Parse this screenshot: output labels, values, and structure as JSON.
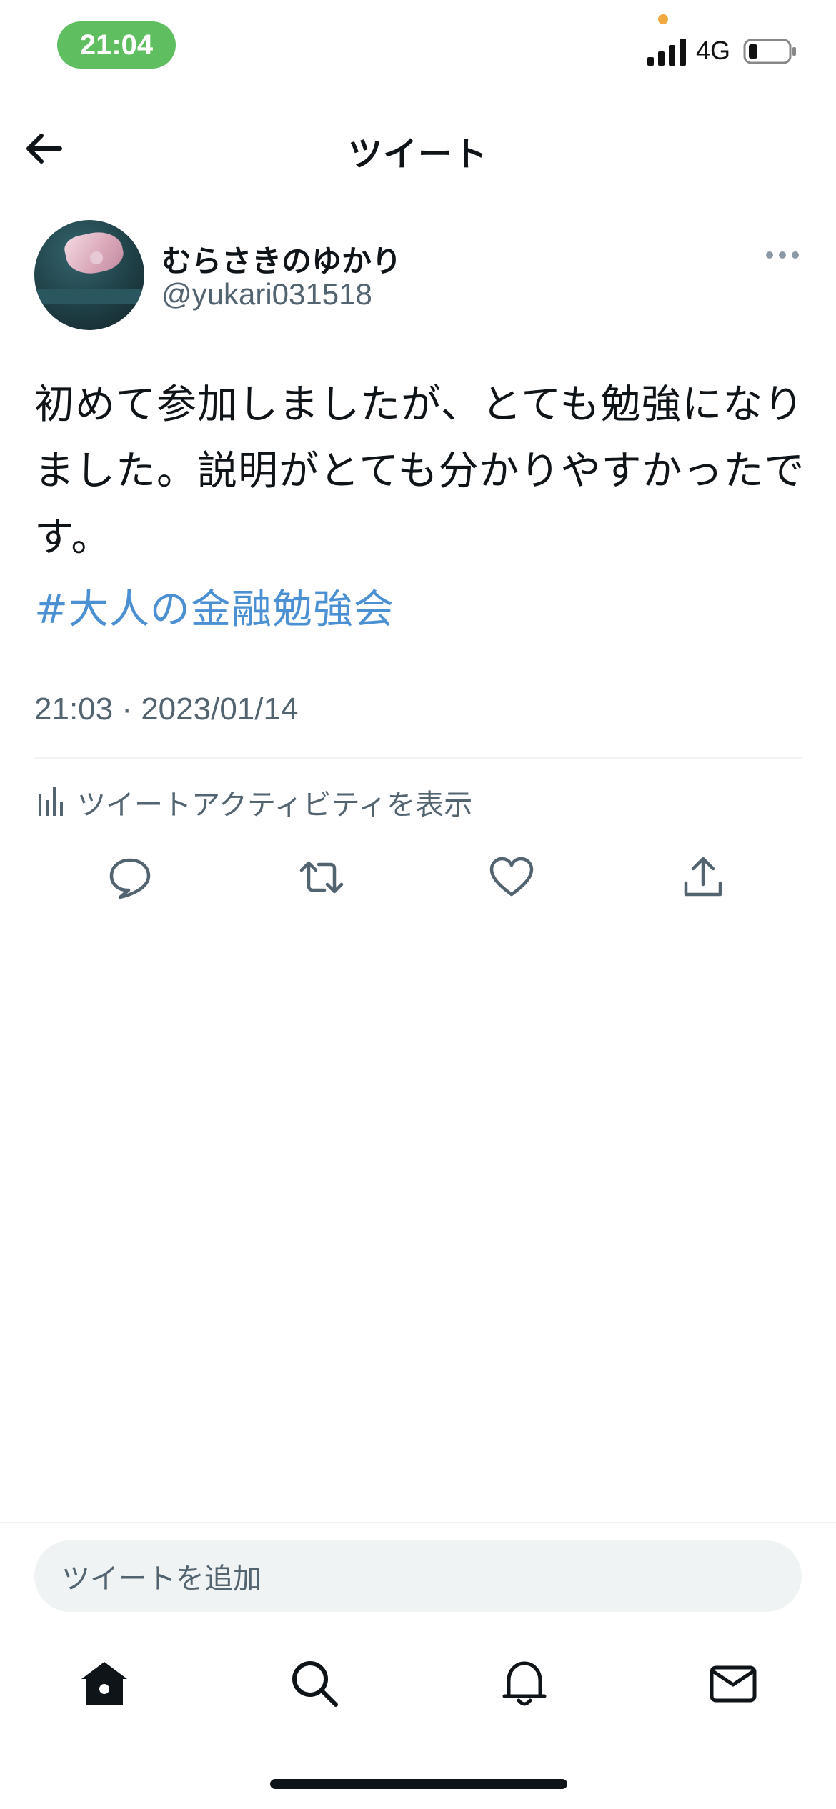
{
  "status_bar": {
    "time": "21:04",
    "network": "4G",
    "time_pill_color": "#5fbf60"
  },
  "header": {
    "title": "ツイート",
    "back_icon": "arrow-left-icon"
  },
  "tweet": {
    "display_name": "むらさきのゆかり",
    "handle": "@yukari031518",
    "text": "初めて参加しましたが、とても勉強になりました。説明がとても分かりやすかったです。",
    "hashtag": "#大人の金融勉強会",
    "timestamp": "21:03 · 2023/01/14",
    "activity_label": "ツイートアクティビティを表示",
    "hashtag_color": "#4a90d2"
  },
  "actions": [
    "reply-icon",
    "retweet-icon",
    "like-icon",
    "share-icon"
  ],
  "reply_input": {
    "placeholder": "ツイートを追加"
  },
  "bottom_nav": [
    "home-icon",
    "search-icon",
    "notifications-icon",
    "messages-icon"
  ]
}
